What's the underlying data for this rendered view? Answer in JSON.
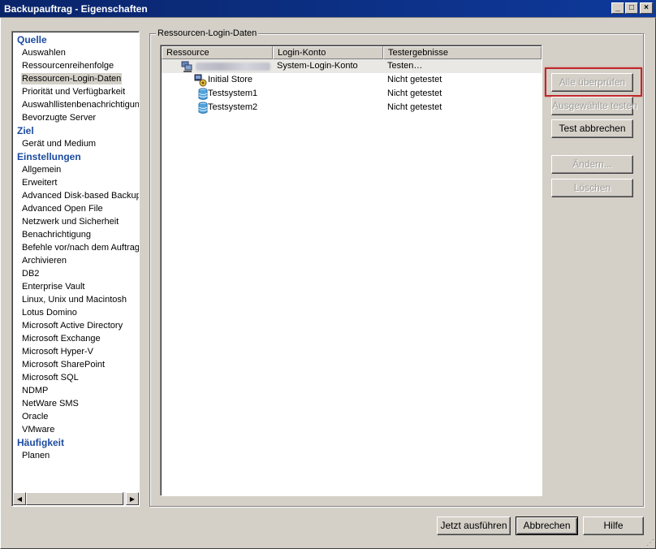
{
  "window": {
    "title": "Backupauftrag - Eigenschaften",
    "controls": {
      "minimize": "_",
      "maximize": "□",
      "close": "×"
    }
  },
  "nav": {
    "sections": [
      {
        "label": "Quelle",
        "items": [
          "Auswahlen",
          "Ressourcenreihenfolge",
          "Ressourcen-Login-Daten",
          "Priorität und Verfügbarkeit",
          "Auswahllistenbenachrichtigung",
          "Bevorzugte Server"
        ]
      },
      {
        "label": "Ziel",
        "items": [
          "Gerät und Medium"
        ]
      },
      {
        "label": "Einstellungen",
        "items": [
          "Allgemein",
          "Erweitert",
          "Advanced Disk-based Backup",
          "Advanced Open File",
          "Netzwerk und Sicherheit",
          "Benachrichtigung",
          "Befehle vor/nach dem Auftrag",
          "Archivieren",
          "DB2",
          "Enterprise Vault",
          "Linux, Unix und Macintosh",
          "Lotus Domino",
          "Microsoft Active Directory",
          "Microsoft Exchange",
          "Microsoft Hyper-V",
          "Microsoft SharePoint",
          "Microsoft SQL",
          "NDMP",
          "NetWare SMS",
          "Oracle",
          "VMware"
        ]
      },
      {
        "label": "Häufigkeit",
        "items": [
          "Planen"
        ]
      }
    ],
    "selected": "Ressourcen-Login-Daten",
    "scroll_left": "◀",
    "scroll_right": "▶"
  },
  "group": {
    "label": "Ressourcen-Login-Daten"
  },
  "table": {
    "columns": [
      "Ressource",
      "Login-Konto",
      "Testergebnisse"
    ],
    "rows": [
      {
        "resource": "",
        "account": "System-Login-Konto",
        "result": "Testen…",
        "icon": "server-group-icon"
      },
      {
        "resource": "Initial Store",
        "account": "",
        "result": "Nicht getestet",
        "icon": "initial-store-icon"
      },
      {
        "resource": "Testsystem1",
        "account": "",
        "result": "Nicht getestet",
        "icon": "database-icon"
      },
      {
        "resource": "Testsystem2",
        "account": "",
        "result": "Nicht getestet",
        "icon": "database-icon"
      }
    ]
  },
  "actions": {
    "test_all": "Alle überprüfen",
    "test_selected": "Ausgewählte testen",
    "cancel_test": "Test abbrechen",
    "edit": "Ändern...",
    "delete": "Löschen"
  },
  "footer": {
    "run_now": "Jetzt ausführen",
    "cancel": "Abbrechen",
    "help": "Hilfe"
  },
  "colors": {
    "title_bar": "#0a246a",
    "section_header": "#1c4ba0",
    "highlight_frame": "#c0282c",
    "window_bg": "#d4d0c8"
  }
}
